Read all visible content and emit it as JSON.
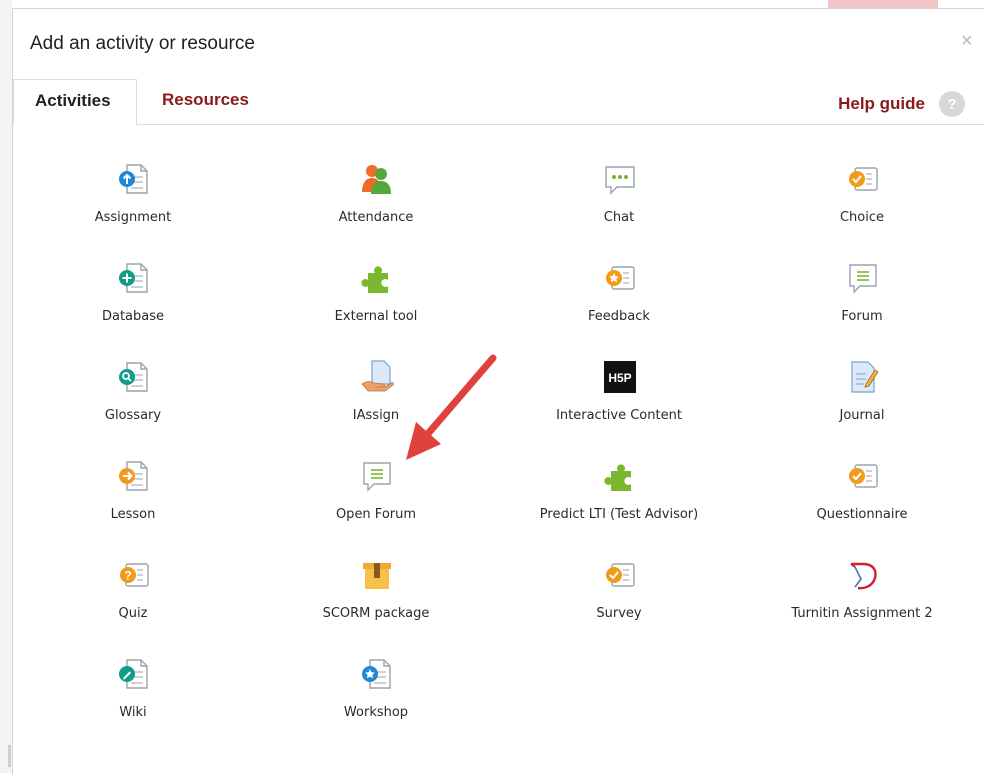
{
  "modal": {
    "title": "Add an activity or resource",
    "close": "×"
  },
  "tabs": [
    {
      "label": "Activities",
      "active": true
    },
    {
      "label": "Resources",
      "active": false
    }
  ],
  "help": {
    "label": "Help guide",
    "icon": "?"
  },
  "activities": [
    {
      "label": "Assignment",
      "icon": "assignment-icon"
    },
    {
      "label": "Attendance",
      "icon": "attendance-icon"
    },
    {
      "label": "Chat",
      "icon": "chat-icon"
    },
    {
      "label": "Choice",
      "icon": "choice-icon"
    },
    {
      "label": "Database",
      "icon": "database-icon"
    },
    {
      "label": "External tool",
      "icon": "external-tool-icon"
    },
    {
      "label": "Feedback",
      "icon": "feedback-icon"
    },
    {
      "label": "Forum",
      "icon": "forum-icon"
    },
    {
      "label": "Glossary",
      "icon": "glossary-icon"
    },
    {
      "label": "IAssign",
      "icon": "iassign-icon"
    },
    {
      "label": "Interactive Content",
      "icon": "h5p-icon",
      "icon_text": "H5P"
    },
    {
      "label": "Journal",
      "icon": "journal-icon"
    },
    {
      "label": "Lesson",
      "icon": "lesson-icon"
    },
    {
      "label": "Open Forum",
      "icon": "open-forum-icon"
    },
    {
      "label": "Predict LTI (Test Advisor)",
      "icon": "external-tool-icon"
    },
    {
      "label": "Questionnaire",
      "icon": "questionnaire-icon"
    },
    {
      "label": "Quiz",
      "icon": "quiz-icon"
    },
    {
      "label": "SCORM package",
      "icon": "scorm-package-icon"
    },
    {
      "label": "Survey",
      "icon": "survey-icon"
    },
    {
      "label": "Turnitin Assignment 2",
      "icon": "turnitin-icon"
    },
    {
      "label": "Wiki",
      "icon": "wiki-icon"
    },
    {
      "label": "Workshop",
      "icon": "workshop-icon"
    }
  ],
  "colors": {
    "accent": "#8b1a1a",
    "annotation_arrow": "#e0413c",
    "blue": "#1e88d6",
    "teal": "#0f9d8a",
    "orange": "#f29a1c",
    "green": "#7bb82f"
  }
}
